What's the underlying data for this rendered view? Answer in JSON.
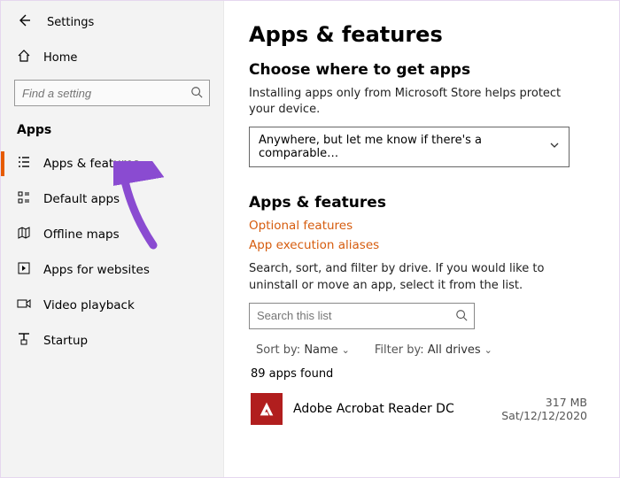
{
  "window": {
    "title": "Settings"
  },
  "sidebar": {
    "home": "Home",
    "search_placeholder": "Find a setting",
    "section": "Apps",
    "items": [
      {
        "label": "Apps & features"
      },
      {
        "label": "Default apps"
      },
      {
        "label": "Offline maps"
      },
      {
        "label": "Apps for websites"
      },
      {
        "label": "Video playback"
      },
      {
        "label": "Startup"
      }
    ]
  },
  "main": {
    "title": "Apps & features",
    "section1_title": "Choose where to get apps",
    "section1_help": "Installing apps only from Microsoft Store helps protect your device.",
    "dropdown_value": "Anywhere, but let me know if there's a comparable…",
    "section2_title": "Apps & features",
    "link_optional": "Optional features",
    "link_aliases": "App execution aliases",
    "filter_help": "Search, sort, and filter by drive. If you would like to uninstall or move an app, select it from the list.",
    "list_search_placeholder": "Search this list",
    "sort_label": "Sort by:",
    "sort_value": "Name",
    "filter_label": "Filter by:",
    "filter_value": "All drives",
    "count_text": "89 apps found",
    "app": {
      "name": "Adobe Acrobat Reader DC",
      "size": "317 MB",
      "date": "Sat/12/12/2020"
    }
  }
}
